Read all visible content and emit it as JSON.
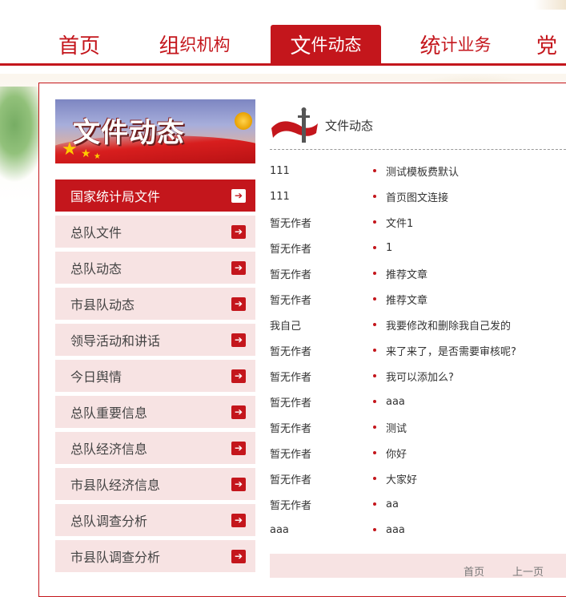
{
  "nav": {
    "items": [
      {
        "big": "首页",
        "small": ""
      },
      {
        "big": "组",
        "small": "织机构"
      },
      {
        "big": "文",
        "small": "件动态"
      },
      {
        "big": "统",
        "small": "计业务"
      },
      {
        "big": "党",
        "small": ""
      }
    ],
    "active_index": 2
  },
  "banner": {
    "title": "文件动态"
  },
  "sidebar": {
    "items": [
      {
        "label": "国家统计局文件"
      },
      {
        "label": "总队文件"
      },
      {
        "label": "总队动态"
      },
      {
        "label": "市县队动态"
      },
      {
        "label": "领导活动和讲话"
      },
      {
        "label": "今日舆情"
      },
      {
        "label": "总队重要信息"
      },
      {
        "label": "总队经济信息"
      },
      {
        "label": "市县队经济信息"
      },
      {
        "label": "总队调查分析"
      },
      {
        "label": "市县队调查分析"
      }
    ],
    "active_index": 0,
    "arrow_glyph": "➔"
  },
  "content": {
    "title": "文件动态",
    "rows": [
      {
        "author": "111",
        "title": "测试模板费默认"
      },
      {
        "author": "111",
        "title": "首页图文连接"
      },
      {
        "author": "暂无作者",
        "title": "文件1"
      },
      {
        "author": "暂无作者",
        "title": "1"
      },
      {
        "author": "暂无作者",
        "title": "推荐文章"
      },
      {
        "author": "暂无作者",
        "title": "推荐文章"
      },
      {
        "author": "我自己",
        "title": "我要修改和删除我自己发的"
      },
      {
        "author": "暂无作者",
        "title": "来了来了，是否需要审核呢?"
      },
      {
        "author": "暂无作者",
        "title": "我可以添加么?"
      },
      {
        "author": "暂无作者",
        "title": "aaa"
      },
      {
        "author": "暂无作者",
        "title": "测试"
      },
      {
        "author": "暂无作者",
        "title": "你好"
      },
      {
        "author": "暂无作者",
        "title": "大家好"
      },
      {
        "author": "暂无作者",
        "title": "aa"
      },
      {
        "author": "aaa",
        "title": "aaa"
      }
    ]
  },
  "pager": {
    "first": "首页",
    "prev": "上一页"
  },
  "colors": {
    "accent": "#c4161c",
    "menu_bg": "#f7e3e3"
  }
}
